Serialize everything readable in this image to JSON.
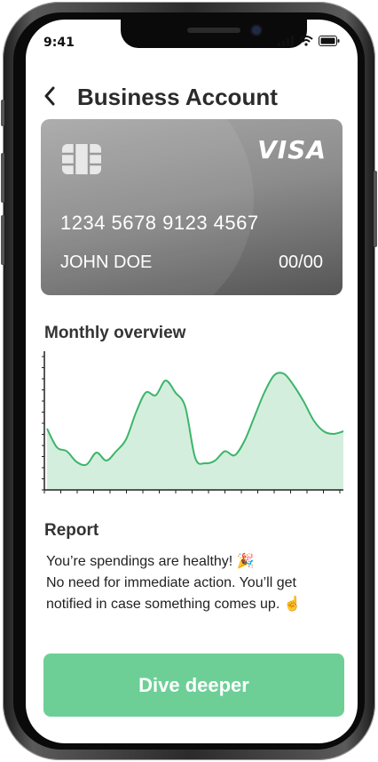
{
  "status_bar": {
    "time": "9:41"
  },
  "header": {
    "title": "Business Account",
    "back_icon": "chevron-left-icon"
  },
  "card": {
    "brand": "VISA",
    "number": "1234 5678 9123 4567",
    "holder": "JOHN DOE",
    "expiry": "00/00",
    "chip_icon": "card-chip-icon"
  },
  "overview": {
    "title": "Monthly overview",
    "line_color": "#3cb56a",
    "fill_color": "#d4eedd"
  },
  "chart_data": {
    "type": "area",
    "x": [
      1,
      2,
      3,
      4,
      5,
      6,
      7,
      8,
      9,
      10,
      11,
      12,
      13,
      14,
      15,
      16,
      17,
      18,
      19,
      20,
      21,
      22,
      23,
      24,
      25,
      26,
      27,
      28,
      29,
      30,
      31
    ],
    "series": [
      {
        "values": [
          46,
          32,
          29,
          21,
          19,
          28,
          22,
          29,
          38,
          58,
          73,
          71,
          82,
          73,
          62,
          24,
          20,
          22,
          29,
          26,
          37,
          55,
          73,
          86,
          87,
          78,
          66,
          52,
          44,
          42,
          44
        ]
      }
    ],
    "ylim": [
      0,
      100
    ]
  },
  "report": {
    "title": "Report",
    "lines": [
      "You’re spendings are healthy! 🎉",
      "No need for immediate action. You’ll get",
      "notified in case something comes up. ☝"
    ]
  },
  "cta": {
    "label": "Dive deeper",
    "color": "#6dcf96"
  }
}
